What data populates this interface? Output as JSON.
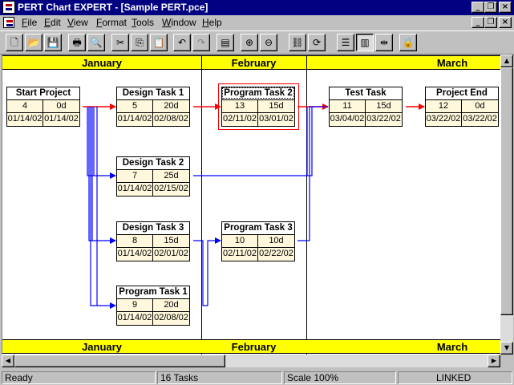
{
  "window": {
    "title": "PERT Chart EXPERT - [Sample PERT.pce]"
  },
  "menu": [
    "File",
    "Edit",
    "View",
    "Format",
    "Tools",
    "Window",
    "Help"
  ],
  "months": [
    "January",
    "February",
    "March"
  ],
  "tasks": [
    {
      "name": "Start Project",
      "id": "4",
      "duration": "0d",
      "start": "01/14/02",
      "finish": "01/14/02",
      "critical": true
    },
    {
      "name": "Design Task 1",
      "id": "5",
      "duration": "20d",
      "start": "01/14/02",
      "finish": "02/08/02",
      "critical": true
    },
    {
      "name": "Program Task 2",
      "id": "13",
      "duration": "15d",
      "start": "02/11/02",
      "finish": "03/01/02",
      "critical": true
    },
    {
      "name": "Test Task",
      "id": "11",
      "duration": "15d",
      "start": "03/04/02",
      "finish": "03/22/02",
      "critical": true
    },
    {
      "name": "Project End",
      "id": "12",
      "duration": "0d",
      "start": "03/22/02",
      "finish": "03/22/02",
      "critical": true
    },
    {
      "name": "Design Task 2",
      "id": "7",
      "duration": "25d",
      "start": "01/14/02",
      "finish": "02/15/02",
      "critical": false
    },
    {
      "name": "Design Task 3",
      "id": "8",
      "duration": "15d",
      "start": "01/14/02",
      "finish": "02/01/02",
      "critical": false
    },
    {
      "name": "Program Task 3",
      "id": "10",
      "duration": "10d",
      "start": "02/11/02",
      "finish": "02/22/02",
      "critical": false
    },
    {
      "name": "Program Task 1",
      "id": "9",
      "duration": "20d",
      "start": "01/14/02",
      "finish": "02/08/02",
      "critical": false
    }
  ],
  "status": {
    "state": "Ready",
    "tasks": "16 Tasks",
    "scale": "Scale 100%",
    "linked": "LINKED"
  },
  "colors": {
    "critical": "#ff0000",
    "noncritical": "#0000ff",
    "timescale": "#ffff00",
    "titlebar": "#000080"
  }
}
